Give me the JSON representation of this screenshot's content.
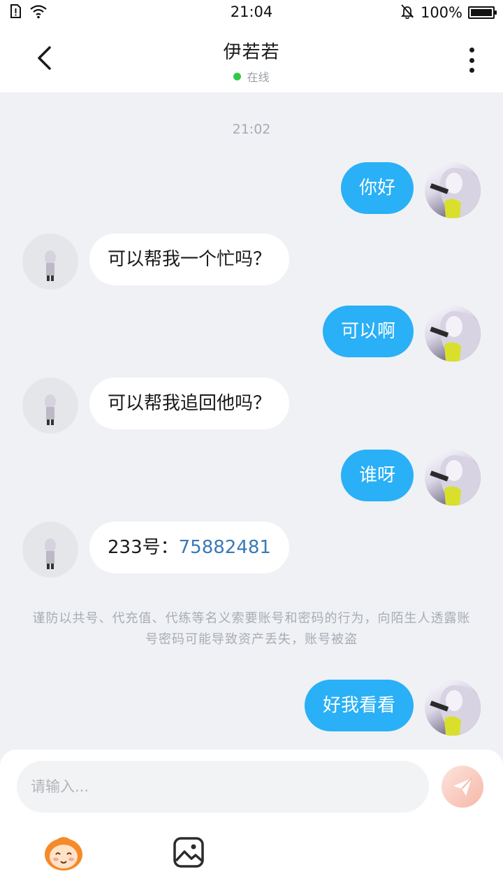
{
  "status_bar": {
    "time": "21:04",
    "battery_label": "100%",
    "icons": [
      "sim-alert-icon",
      "wifi-icon",
      "mute-bell-icon",
      "battery-icon"
    ]
  },
  "header": {
    "title": "伊若若",
    "status": "在线",
    "status_color": "#2fc84a"
  },
  "chat": {
    "timestamp": "21:02",
    "messages": [
      {
        "from": "self",
        "text": "你好"
      },
      {
        "from": "other",
        "text": "可以帮我一个忙吗？"
      },
      {
        "from": "self",
        "text": "可以啊"
      },
      {
        "from": "other",
        "text": "可以帮我追回他吗？"
      },
      {
        "from": "self",
        "text": "谁呀"
      },
      {
        "from": "other",
        "text_prefix": "233号：",
        "link_text": "75882481"
      },
      {
        "from": "self",
        "text": "好我看看"
      }
    ],
    "notice": "谨防以共号、代充值、代练等名义索要账号和密码的行为，向陌生人透露账号密码可能导致资产丢失，账号被盗"
  },
  "input": {
    "placeholder": "请输入..."
  },
  "colors": {
    "self_bubble": "#29b0f6",
    "other_bubble": "#ffffff",
    "background": "#eff1f5",
    "link": "#3a79b8"
  }
}
